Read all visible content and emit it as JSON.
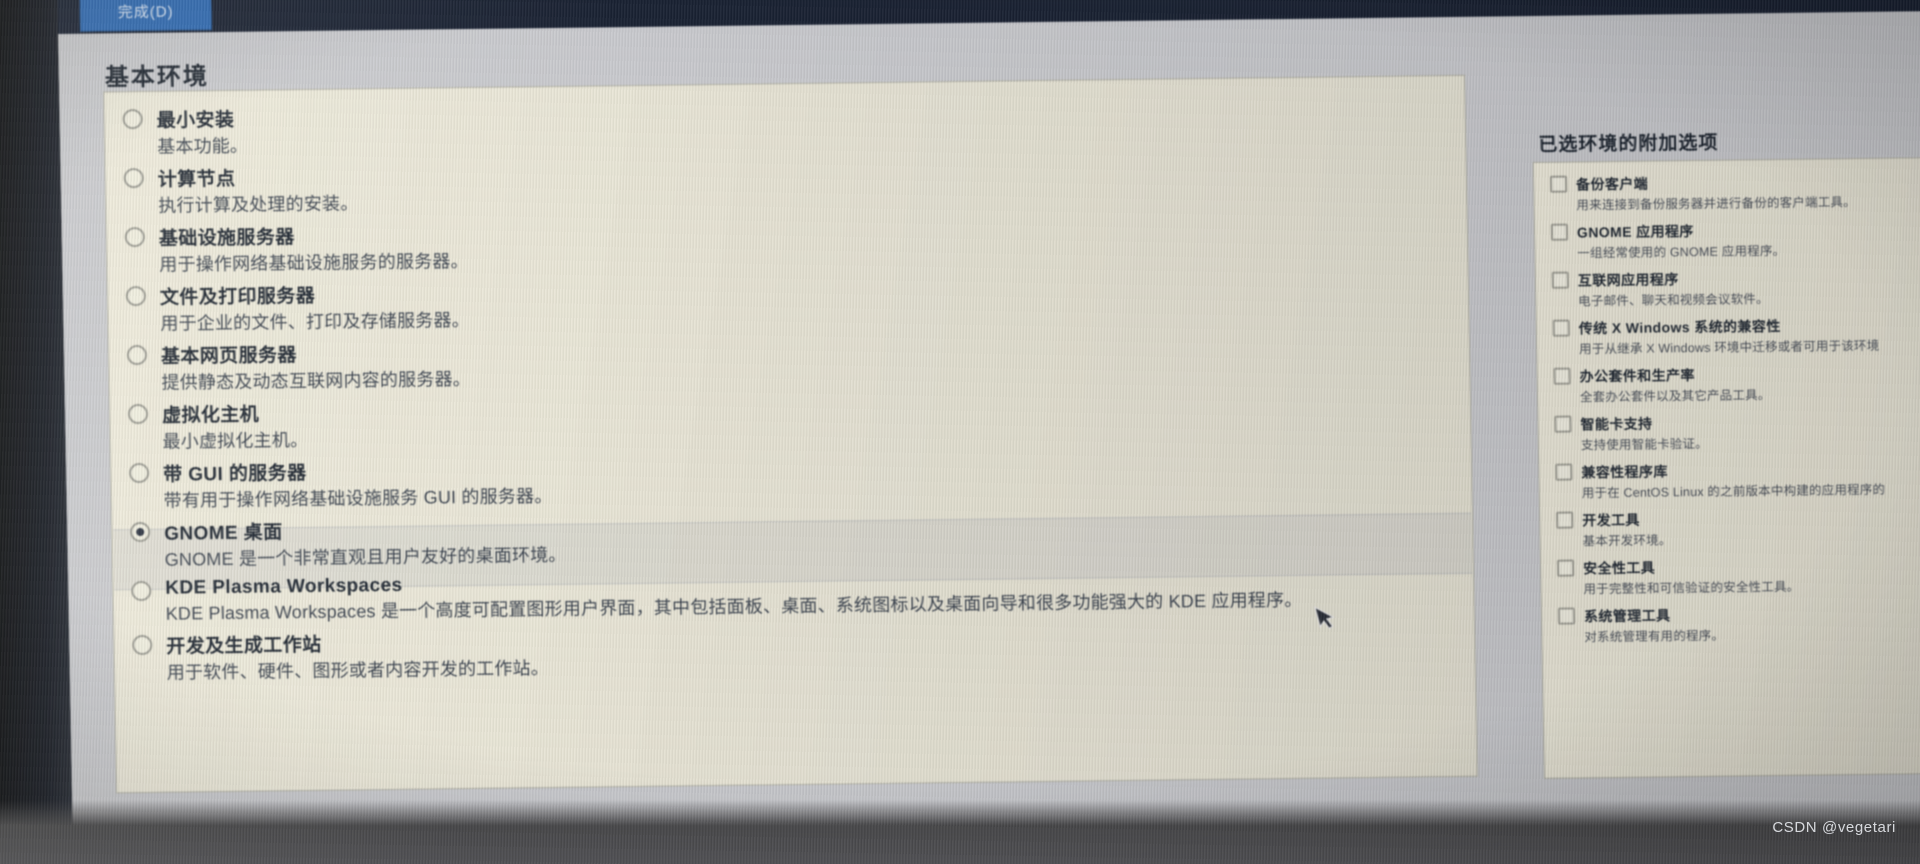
{
  "toolbar": {
    "done_label": "完成(D)"
  },
  "environment": {
    "heading": "基本环境",
    "items": [
      {
        "title": "最小安装",
        "desc": "基本功能。",
        "selected": false
      },
      {
        "title": "计算节点",
        "desc": "执行计算及处理的安装。",
        "selected": false
      },
      {
        "title": "基础设施服务器",
        "desc": "用于操作网络基础设施服务的服务器。",
        "selected": false
      },
      {
        "title": "文件及打印服务器",
        "desc": "用于企业的文件、打印及存储服务器。",
        "selected": false
      },
      {
        "title": "基本网页服务器",
        "desc": "提供静态及动态互联网内容的服务器。",
        "selected": false
      },
      {
        "title": "虚拟化主机",
        "desc": "最小虚拟化主机。",
        "selected": false
      },
      {
        "title": "带 GUI 的服务器",
        "desc": "带有用于操作网络基础设施服务 GUI 的服务器。",
        "selected": false
      },
      {
        "title": "GNOME 桌面",
        "desc": "GNOME 是一个非常直观且用户友好的桌面环境。",
        "selected": true
      },
      {
        "title": "KDE Plasma Workspaces",
        "desc": "KDE Plasma Workspaces 是一个高度可配置图形用户界面，其中包括面板、桌面、系统图标以及桌面向导和很多功能强大的 KDE 应用程序。",
        "selected": false
      },
      {
        "title": "开发及生成工作站",
        "desc": "用于软件、硬件、图形或者内容开发的工作站。",
        "selected": false
      }
    ]
  },
  "addons": {
    "heading": "已选环境的附加选项",
    "items": [
      {
        "title": "备份客户端",
        "desc": "用来连接到备份服务器并进行备份的客户端工具。",
        "checked": false
      },
      {
        "title": "GNOME 应用程序",
        "desc": "一组经常使用的 GNOME 应用程序。",
        "checked": false
      },
      {
        "title": "互联网应用程序",
        "desc": "电子邮件、聊天和视频会议软件。",
        "checked": false
      },
      {
        "title": "传统 X Windows 系统的兼容性",
        "desc": "用于从继承 X Windows 环境中迁移或者可用于该环境",
        "checked": false
      },
      {
        "title": "办公套件和生产率",
        "desc": "全套办公套件以及其它产品工具。",
        "checked": false
      },
      {
        "title": "智能卡支持",
        "desc": "支持使用智能卡验证。",
        "checked": false
      },
      {
        "title": "兼容性程序库",
        "desc": "用于在 CentOS Linux 的之前版本中构建的应用程序的",
        "checked": false
      },
      {
        "title": "开发工具",
        "desc": "基本开发环境。",
        "checked": false
      },
      {
        "title": "安全性工具",
        "desc": "用于完整性和可信验证的安全性工具。",
        "checked": false
      },
      {
        "title": "系统管理工具",
        "desc": "对系统管理有用的程序。",
        "checked": false
      }
    ]
  },
  "watermark": {
    "text": "CSDN @vegetari"
  },
  "colors": {
    "accent": "#2f6bb5",
    "panel": "#e8e6d8",
    "dialog": "#c9cace",
    "text": "#1f2732"
  }
}
